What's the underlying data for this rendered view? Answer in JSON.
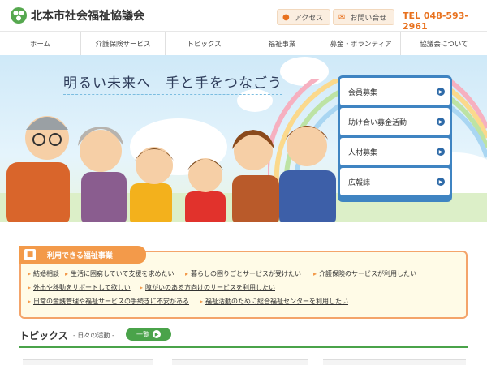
{
  "header": {
    "logo_text": "北本市社会福祉協議会",
    "access_label": "アクセス",
    "contact_label": "お問い合せ",
    "tel": "TEL 048-593-2961"
  },
  "nav": {
    "items": [
      "ホーム",
      "介護保険サービス",
      "トピックス",
      "福祉事業",
      "募金・ボランティア",
      "協議会について"
    ]
  },
  "hero": {
    "title": "明るい未来へ　手と手をつなごう"
  },
  "side_menu": {
    "items": [
      "会員募集",
      "助け合い募金活動",
      "人材募集",
      "広報誌"
    ]
  },
  "services": {
    "title": "利用できる福祉事業",
    "items": [
      "結婚相談",
      "生活に困窮していて支援を求めたい",
      "暮らしの困りごとサービスが受けたい",
      "介護保険のサービスが利用したい",
      "外出や移動をサポートして欲しい",
      "障がいのある方向けのサービスを利用したい",
      "日常の金銭管理や福祉サービスの手続きに不安がある",
      "福祉活動のために総合福祉センターを利用したい"
    ]
  },
  "topics": {
    "title": "トピックス",
    "subtitle": "- 日々の活動 -",
    "list_button": "一覧"
  },
  "colors": {
    "accent_orange": "#e8711e",
    "blue": "#3f84c2",
    "green": "#4aa34a"
  }
}
